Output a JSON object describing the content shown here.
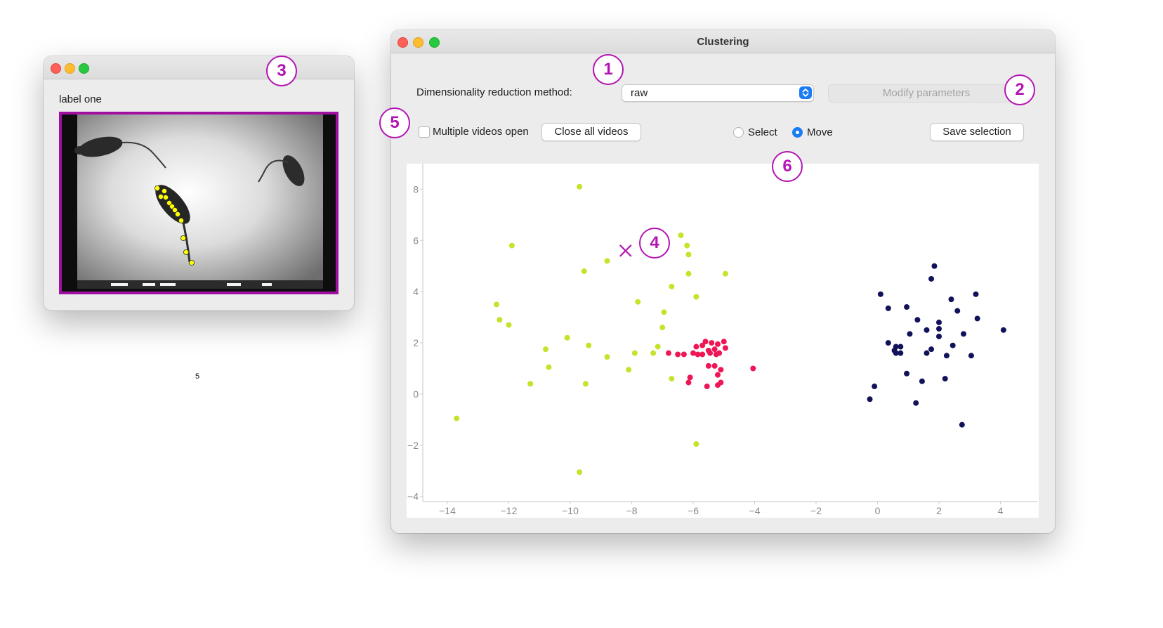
{
  "video_window": {
    "label": "label one",
    "frame_number": "5",
    "border_color": "#a010a0",
    "keypoint_color": "#ffff00"
  },
  "clustering_window": {
    "title": "Clustering",
    "dim_reduction_label": "Dimensionality reduction method:",
    "dim_reduction_value": "raw",
    "modify_parameters_label": "Modify parameters",
    "multiple_videos_label": "Multiple videos open",
    "multiple_videos_checked": false,
    "close_all_videos_label": "Close all videos",
    "select_label": "Select",
    "move_label": "Move",
    "selected_mode": "Move",
    "save_selection_label": "Save selection"
  },
  "callouts": [
    "1",
    "2",
    "3",
    "4",
    "5",
    "6"
  ],
  "marker_color": "#b314b3",
  "chart_data": {
    "type": "scatter",
    "title": "",
    "xlabel": "",
    "ylabel": "",
    "xlim": [
      -14.8,
      5.2
    ],
    "ylim": [
      -4.2,
      9.0
    ],
    "xticks": [
      -14,
      -12,
      -10,
      -8,
      -6,
      -4,
      -2,
      0,
      2,
      4
    ],
    "yticks": [
      -4,
      -2,
      0,
      2,
      4,
      6,
      8
    ],
    "grid": false,
    "marker": {
      "x": -8.2,
      "y": 5.6,
      "symbol": "x"
    },
    "series": [
      {
        "color": "#c5e32a",
        "points": [
          [
            -9.7,
            8.1
          ],
          [
            -11.9,
            5.8
          ],
          [
            -9.55,
            4.8
          ],
          [
            -8.8,
            5.2
          ],
          [
            -6.4,
            6.2
          ],
          [
            -6.2,
            5.8
          ],
          [
            -6.15,
            5.45
          ],
          [
            -6.15,
            4.7
          ],
          [
            -4.95,
            4.7
          ],
          [
            -6.7,
            4.2
          ],
          [
            -5.9,
            3.8
          ],
          [
            -12.4,
            3.5
          ],
          [
            -7.8,
            3.6
          ],
          [
            -6.95,
            3.2
          ],
          [
            -12.3,
            2.9
          ],
          [
            -12.0,
            2.7
          ],
          [
            -7.0,
            2.6
          ],
          [
            -10.1,
            2.2
          ],
          [
            -10.8,
            1.75
          ],
          [
            -9.4,
            1.9
          ],
          [
            -7.15,
            1.85
          ],
          [
            -7.3,
            1.6
          ],
          [
            -7.9,
            1.6
          ],
          [
            -8.8,
            1.45
          ],
          [
            -10.7,
            1.05
          ],
          [
            -8.1,
            0.95
          ],
          [
            -6.7,
            0.6
          ],
          [
            -9.5,
            0.4
          ],
          [
            -11.3,
            0.4
          ],
          [
            -13.7,
            -0.95
          ],
          [
            -5.9,
            -1.95
          ],
          [
            -9.7,
            -3.05
          ]
        ]
      },
      {
        "color": "#ee1655",
        "points": [
          [
            -5.9,
            1.85
          ],
          [
            -5.6,
            2.05
          ],
          [
            -5.4,
            2.0
          ],
          [
            -5.2,
            1.95
          ],
          [
            -5.0,
            2.05
          ],
          [
            -4.95,
            1.8
          ],
          [
            -5.7,
            1.9
          ],
          [
            -5.5,
            1.7
          ],
          [
            -5.3,
            1.75
          ],
          [
            -5.85,
            1.55
          ],
          [
            -5.7,
            1.55
          ],
          [
            -5.45,
            1.6
          ],
          [
            -5.25,
            1.55
          ],
          [
            -5.15,
            1.6
          ],
          [
            -6.0,
            1.6
          ],
          [
            -6.3,
            1.55
          ],
          [
            -6.5,
            1.55
          ],
          [
            -6.8,
            1.6
          ],
          [
            -5.5,
            1.1
          ],
          [
            -5.3,
            1.1
          ],
          [
            -5.1,
            0.95
          ],
          [
            -5.2,
            0.75
          ],
          [
            -6.1,
            0.65
          ],
          [
            -6.15,
            0.45
          ],
          [
            -5.55,
            0.3
          ],
          [
            -5.2,
            0.35
          ],
          [
            -5.1,
            0.45
          ],
          [
            -4.05,
            1.0
          ]
        ]
      },
      {
        "color": "#12125a",
        "points": [
          [
            1.85,
            5.0
          ],
          [
            1.75,
            4.5
          ],
          [
            0.1,
            3.9
          ],
          [
            3.2,
            3.9
          ],
          [
            2.4,
            3.7
          ],
          [
            0.35,
            3.35
          ],
          [
            0.95,
            3.4
          ],
          [
            2.6,
            3.25
          ],
          [
            1.3,
            2.9
          ],
          [
            3.25,
            2.95
          ],
          [
            2.0,
            2.8
          ],
          [
            1.6,
            2.5
          ],
          [
            2.0,
            2.55
          ],
          [
            4.1,
            2.5
          ],
          [
            1.05,
            2.35
          ],
          [
            2.0,
            2.25
          ],
          [
            2.8,
            2.35
          ],
          [
            0.35,
            2.0
          ],
          [
            0.6,
            1.85
          ],
          [
            0.75,
            1.85
          ],
          [
            2.45,
            1.9
          ],
          [
            0.55,
            1.7
          ],
          [
            1.75,
            1.75
          ],
          [
            0.6,
            1.6
          ],
          [
            0.75,
            1.6
          ],
          [
            1.6,
            1.6
          ],
          [
            2.25,
            1.5
          ],
          [
            3.05,
            1.5
          ],
          [
            0.95,
            0.8
          ],
          [
            1.45,
            0.5
          ],
          [
            2.2,
            0.6
          ],
          [
            -0.1,
            0.3
          ],
          [
            -0.25,
            -0.2
          ],
          [
            1.25,
            -0.35
          ],
          [
            2.75,
            -1.2
          ]
        ]
      }
    ]
  }
}
